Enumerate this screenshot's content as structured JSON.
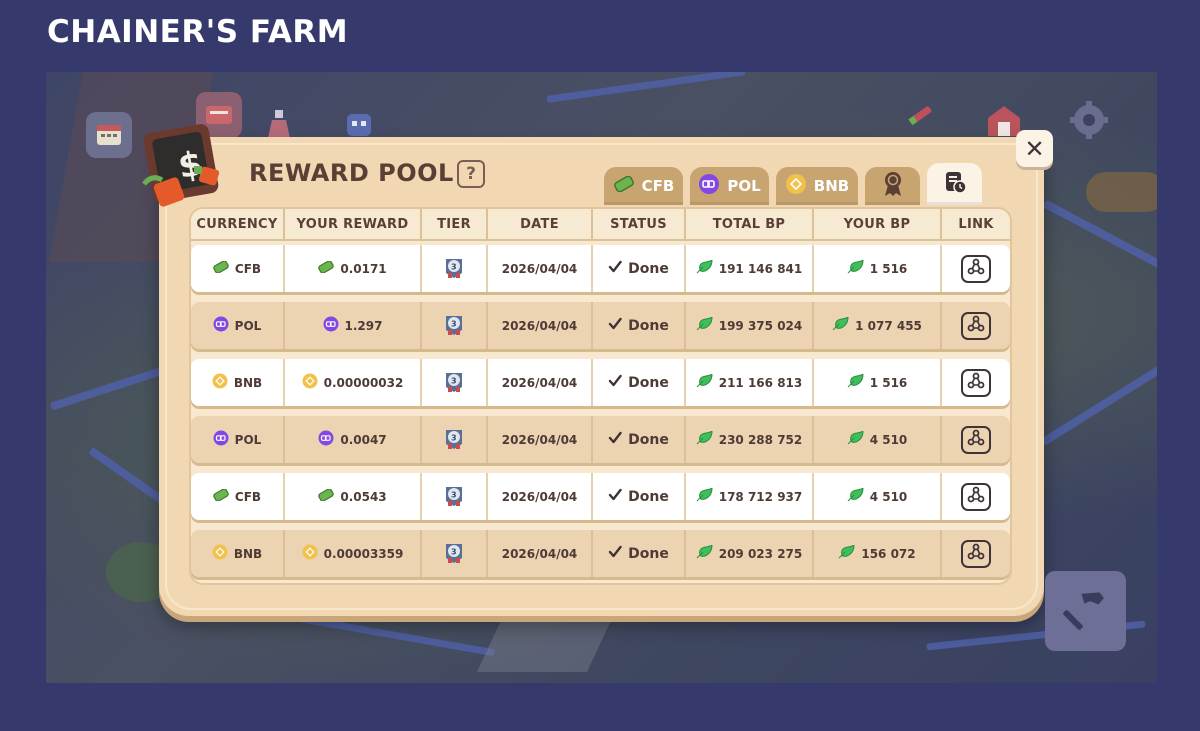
{
  "site": {
    "title": "CHAINER'S FARM"
  },
  "dialog": {
    "title": "REWARD POOL",
    "help_label": "?",
    "close_label": "✕"
  },
  "tabs": [
    {
      "label": "CFB",
      "icon": "cfb-token-icon",
      "active": false
    },
    {
      "label": "POL",
      "icon": "pol-token-icon",
      "active": false
    },
    {
      "label": "BNB",
      "icon": "bnb-token-icon",
      "active": false
    },
    {
      "label": "",
      "icon": "ribbon-medal-icon",
      "active": false
    },
    {
      "label": "",
      "icon": "history-clock-icon",
      "active": true
    }
  ],
  "table": {
    "columns": [
      "CURRENCY",
      "YOUR REWARD",
      "TIER",
      "DATE",
      "STATUS",
      "TOTAL BP",
      "YOUR BP",
      "LINK"
    ],
    "rows": [
      {
        "currency": "CFB",
        "reward": "0.0171",
        "date": "2026/04/04",
        "status": "Done",
        "total_bp": "191 146 841",
        "your_bp": "1 516",
        "style": "light"
      },
      {
        "currency": "POL",
        "reward": "1.297",
        "date": "2026/04/04",
        "status": "Done",
        "total_bp": "199 375 024",
        "your_bp": "1 077 455",
        "style": "dark"
      },
      {
        "currency": "BNB",
        "reward": "0.00000032",
        "date": "2026/04/04",
        "status": "Done",
        "total_bp": "211 166 813",
        "your_bp": "1 516",
        "style": "light"
      },
      {
        "currency": "POL",
        "reward": "0.0047",
        "date": "2026/04/04",
        "status": "Done",
        "total_bp": "230 288 752",
        "your_bp": "4 510",
        "style": "dark"
      },
      {
        "currency": "CFB",
        "reward": "0.0543",
        "date": "2026/04/04",
        "status": "Done",
        "total_bp": "178 712 937",
        "your_bp": "4 510",
        "style": "light"
      },
      {
        "currency": "BNB",
        "reward": "0.00003359",
        "date": "2026/04/04",
        "status": "Done",
        "total_bp": "209 023 275",
        "your_bp": "156 072",
        "style": "dark"
      }
    ]
  },
  "colors": {
    "page_bg": "#36396b",
    "dialog_bg": "#f1d8b2",
    "tab_bg": "#c8a470",
    "cfb": "#5fa84a",
    "pol": "#8247e5",
    "bnb": "#e8b43c",
    "bp_leaf": "#3fbf5a"
  }
}
